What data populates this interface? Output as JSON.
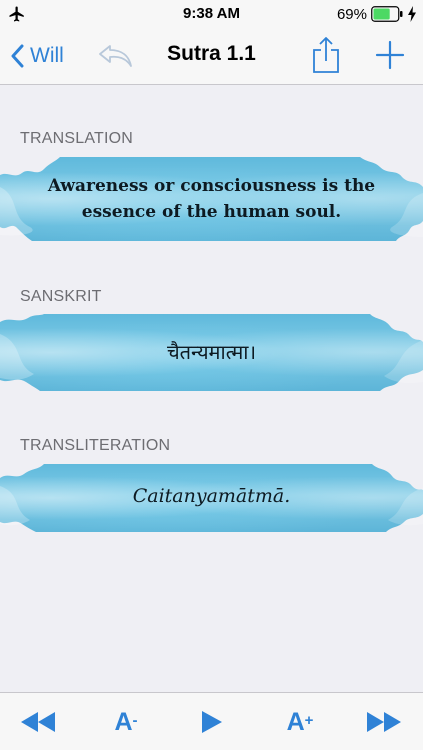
{
  "status_bar": {
    "time": "9:38 AM",
    "battery_percent": "69%",
    "battery_level": 0.69,
    "icons": [
      "airplane-icon",
      "battery-icon",
      "charging-bolt-icon"
    ]
  },
  "nav": {
    "back_label": "Will",
    "title": "Sutra 1.1",
    "icons": [
      "chevron-left-icon",
      "undo-arrow-icon",
      "share-icon",
      "plus-icon"
    ]
  },
  "sections": [
    {
      "header": "TRANSLATION",
      "text": "Awareness or consciousness is the essence of the human soul."
    },
    {
      "header": "SANSKRIT",
      "text": "चैतन्यमात्मा।"
    },
    {
      "header": "TRANSLITERATION",
      "text": "Caitanyamātmā."
    }
  ],
  "toolbar": {
    "decrease_font_label": "A",
    "decrease_font_sign": "-",
    "increase_font_label": "A",
    "increase_font_sign": "+",
    "icons": [
      "rewind-icon",
      "play-icon",
      "fast-forward-icon"
    ]
  },
  "colors": {
    "accent": "#2f82d6",
    "banner": "#6cc1e2",
    "background": "#efeff4"
  }
}
